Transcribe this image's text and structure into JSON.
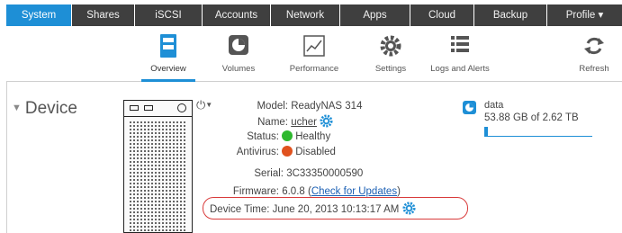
{
  "nav": {
    "tabs": [
      "System",
      "Shares",
      "iSCSI",
      "Accounts",
      "Network",
      "Apps",
      "Cloud",
      "Backup",
      "Profile ▾"
    ],
    "active": "System"
  },
  "toolbar": {
    "items": [
      "Overview",
      "Volumes",
      "Performance",
      "Settings",
      "Logs and Alerts",
      "Refresh"
    ],
    "active": "Overview"
  },
  "device": {
    "title": "Device",
    "model_label": "Model:",
    "model": "ReadyNAS 314",
    "name_label": "Name:",
    "name": "ucher",
    "status_label": "Status:",
    "status": "Healthy",
    "antivirus_label": "Antivirus:",
    "antivirus": "Disabled",
    "serial_label": "Serial:",
    "serial": "3C33350000590",
    "firmware_label": "Firmware:",
    "firmware": "6.0.8",
    "firmware_link": "Check for Updates",
    "time_label": "Device Time:",
    "time": "June 20, 2013 10:13:17 AM"
  },
  "volume": {
    "name": "data",
    "usage": "53.88 GB of 2.62 TB",
    "fill_fraction": 0.02
  },
  "colors": {
    "accent": "#1e8fd6",
    "nav_bg": "#3f3f3f",
    "healthy": "#2eb82e",
    "disabled": "#e0521e",
    "highlight": "#d93b3b"
  }
}
